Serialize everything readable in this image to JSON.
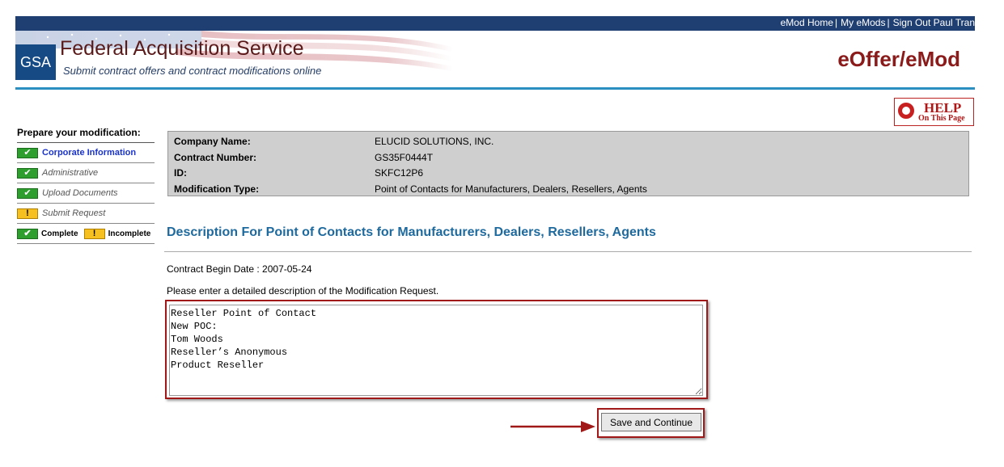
{
  "topnav": {
    "links": [
      "eMod Home",
      "My eMods",
      "Sign Out Paul Tran"
    ]
  },
  "header": {
    "logo": "GSA",
    "title": "Federal Acquisition Service",
    "subtitle": "Submit contract offers and contract modifications online",
    "app_title": "eOffer/eMod"
  },
  "help": {
    "label": "HELP",
    "sub": "On This Page"
  },
  "sidebar": {
    "title": "Prepare your modification:",
    "items": [
      {
        "label": "Corporate Information",
        "status": "complete",
        "style": "link"
      },
      {
        "label": "Administrative",
        "status": "complete",
        "style": "italic"
      },
      {
        "label": "Upload Documents",
        "status": "complete",
        "style": "italic"
      },
      {
        "label": "Submit Request",
        "status": "incomplete",
        "style": "italic"
      }
    ],
    "legend": {
      "complete": "Complete",
      "incomplete": "Incomplete"
    }
  },
  "info": {
    "rows": [
      {
        "label": "Company Name:",
        "value": "ELUCID SOLUTIONS, INC."
      },
      {
        "label": "Contract Number:",
        "value": "GS35F0444T"
      },
      {
        "label": "ID:",
        "value": "SKFC12P6"
      },
      {
        "label": "Modification Type:",
        "value": "Point of Contacts for Manufacturers, Dealers, Resellers, Agents"
      }
    ]
  },
  "main": {
    "heading": "Description For Point of Contacts for Manufacturers, Dealers, Resellers, Agents",
    "begin_date": "Contract Begin Date : 2007-05-24",
    "instruction": "Please enter a detailed description of the Modification Request.",
    "description_value": "Reseller Point of Contact\nNew POC:\nTom Woods\nReseller’s Anonymous\nProduct Reseller",
    "save_label": "Save and Continue"
  },
  "colors": {
    "topbar": "#1f3f73",
    "header_rule": "#2b8fc2",
    "app_title": "#8b1a1a",
    "heading": "#1e6a9e",
    "highlight": "#a01818",
    "check": "#2e9e2e",
    "warn": "#f5c020"
  }
}
